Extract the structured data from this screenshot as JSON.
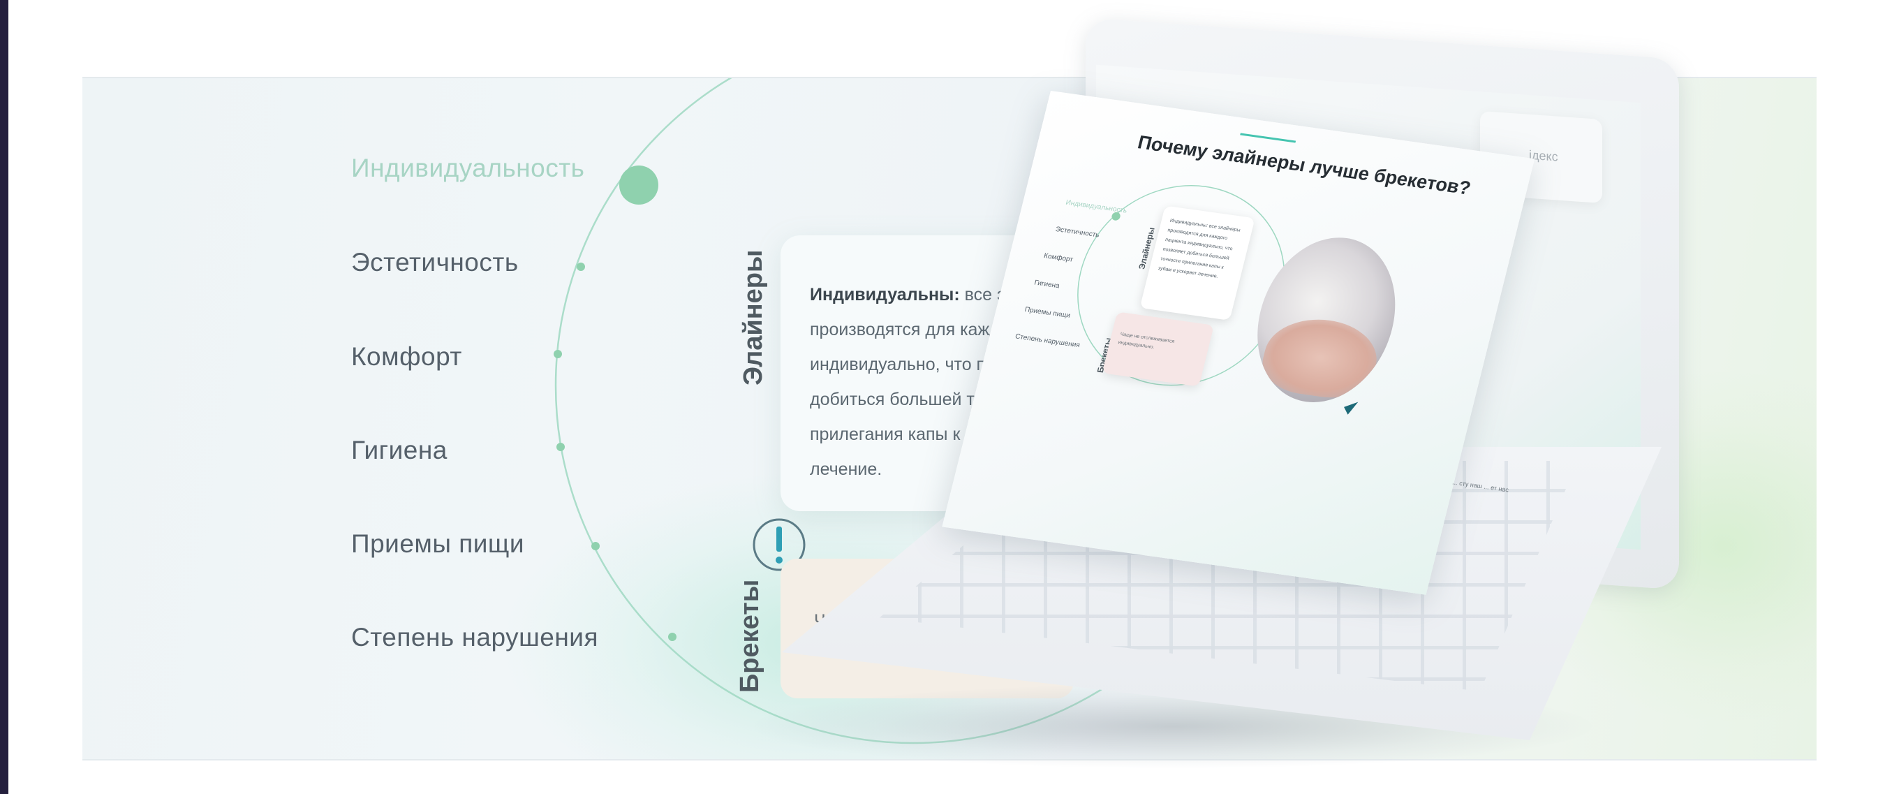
{
  "menu": {
    "items": [
      {
        "label": "Индивидуальность",
        "active": true
      },
      {
        "label": "Эстетичность",
        "active": false
      },
      {
        "label": "Комфорт",
        "active": false
      },
      {
        "label": "Гигиена",
        "active": false
      },
      {
        "label": "Приемы пищи",
        "active": false
      },
      {
        "label": "Степень нарушения",
        "active": false
      }
    ]
  },
  "card": {
    "vertical_label": "Элайнеры",
    "lead": "Индивидуальны:",
    "lines": [
      " все элай",
      "производятся для каждо",
      "индивидуально, что позі",
      "добиться большей точн",
      "прилегания капы к зубі",
      "лечение."
    ]
  },
  "card2": {
    "vertical_label": "Брекеты",
    "text": "Ча"
  },
  "slide": {
    "title": "Почему элайнеры лучше брекетов?",
    "menu": [
      "Индивидуальность",
      "Эстетичность",
      "Комфорт",
      "Гигиена",
      "Приемы пищи",
      "Степень нарушения"
    ],
    "label_top": "Элайнеры",
    "label_bottom": "Брекеты",
    "card_text": "Индивидуальны: все элайнеры производятся для каждого пациента индивидуально, что позволяет добиться большей точности прилегания капы к зубам и ускоряет лечение.",
    "card2_text": "Чаще не отслеживается индивидуально.",
    "corner_note": "... сту наш\n... ет нас",
    "side_label": "ідекс"
  },
  "colors": {
    "accent": "#45c4b0",
    "active_menu": "#a7d4c4",
    "circle_stroke": "#9fd8c2",
    "text": "#55606a"
  },
  "icons": [
    "alert-speech-bubble-icon",
    "triangle-decoration-icon"
  ]
}
